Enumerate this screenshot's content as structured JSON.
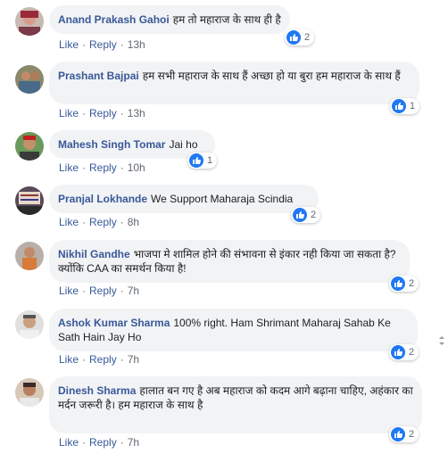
{
  "actions": {
    "like": "Like",
    "reply": "Reply",
    "dot": "·"
  },
  "comments": [
    {
      "author": "Anand Prakash Gahoi",
      "text": "हम तो महाराज के साथ ही है",
      "reactions": "2",
      "time": "13h"
    },
    {
      "author": "Prashant Bajpai",
      "text": "हम सभी महाराज के साथ हैं अच्छा हो या बुरा हम महाराज के साथ हैं",
      "reactions": "1",
      "time": "13h"
    },
    {
      "author": "Mahesh Singh Tomar",
      "text": "Jai ho",
      "reactions": "1",
      "time": "10h"
    },
    {
      "author": "Pranjal Lokhande",
      "text": "We Support Maharaja Scindia",
      "reactions": "2",
      "time": "8h"
    },
    {
      "author": "Nikhil Gandhe",
      "text": "भाजपा मे शामिल होने की संभावना से इंकार नही किया जा सकता है?क्योंकि CAA का समर्थन किया है!",
      "reactions": "2",
      "time": "7h"
    },
    {
      "author": "Ashok Kumar Sharma",
      "text": "100% right. Ham Shrimant Maharaj Sahab Ke Sath Hain Jay Ho",
      "reactions": "2",
      "time": "7h"
    },
    {
      "author": "Dinesh Sharma",
      "text": "हालात बन गए है अब महाराज को कदम आगे बढ़ाना चाहिए, अहंकार का मर्दन जरूरी है। हम महाराज के साथ है",
      "reactions": "2",
      "time": "7h"
    }
  ],
  "colors": {
    "link": "#385898",
    "bubble": "#f2f3f5",
    "like": "#2078f4",
    "meta": "#606770"
  }
}
